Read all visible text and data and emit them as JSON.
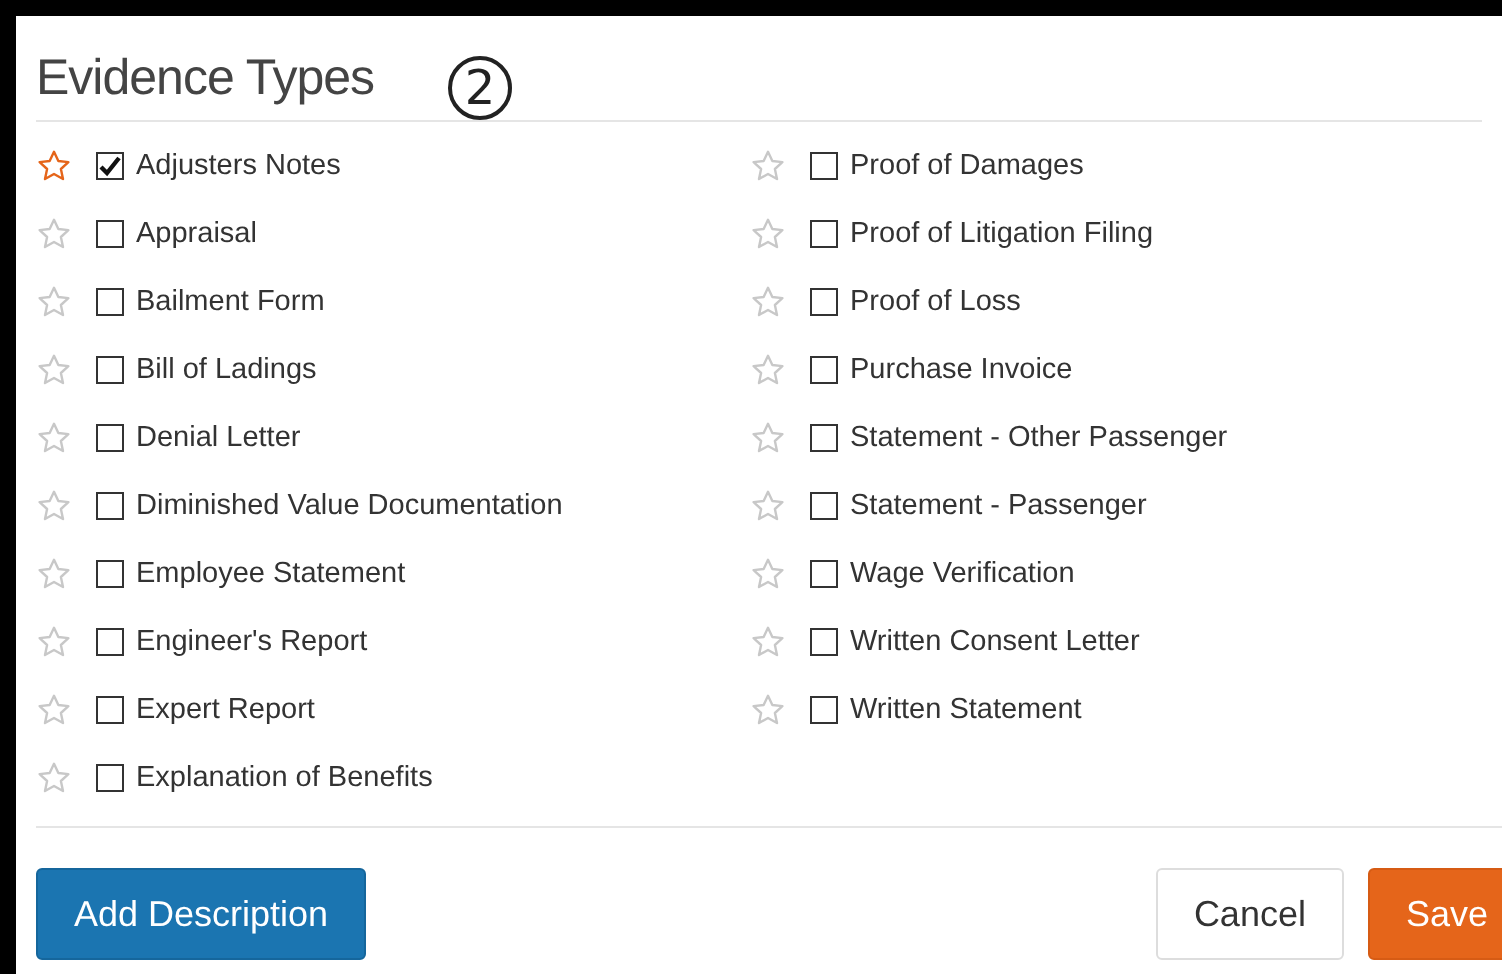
{
  "title": "Evidence Types",
  "annotation": "2",
  "columns": [
    [
      {
        "label": "Adjusters Notes",
        "starred": true,
        "checked": true
      },
      {
        "label": "Appraisal",
        "starred": false,
        "checked": false
      },
      {
        "label": "Bailment Form",
        "starred": false,
        "checked": false
      },
      {
        "label": "Bill of Ladings",
        "starred": false,
        "checked": false
      },
      {
        "label": "Denial Letter",
        "starred": false,
        "checked": false
      },
      {
        "label": "Diminished Value Documentation",
        "starred": false,
        "checked": false
      },
      {
        "label": "Employee Statement",
        "starred": false,
        "checked": false
      },
      {
        "label": "Engineer's Report",
        "starred": false,
        "checked": false
      },
      {
        "label": "Expert Report",
        "starred": false,
        "checked": false
      },
      {
        "label": "Explanation of Benefits",
        "starred": false,
        "checked": false
      }
    ],
    [
      {
        "label": "Proof of Damages",
        "starred": false,
        "checked": false
      },
      {
        "label": "Proof of Litigation Filing",
        "starred": false,
        "checked": false
      },
      {
        "label": "Proof of Loss",
        "starred": false,
        "checked": false
      },
      {
        "label": "Purchase Invoice",
        "starred": false,
        "checked": false
      },
      {
        "label": "Statement - Other Passenger",
        "starred": false,
        "checked": false
      },
      {
        "label": "Statement - Passenger",
        "starred": false,
        "checked": false
      },
      {
        "label": "Wage Verification",
        "starred": false,
        "checked": false
      },
      {
        "label": "Written Consent Letter",
        "starred": false,
        "checked": false
      },
      {
        "label": "Written Statement",
        "starred": false,
        "checked": false
      }
    ]
  ],
  "buttons": [
    {
      "label": "Add Description",
      "kind": "primary"
    },
    {
      "label": "Cancel",
      "kind": "default"
    },
    {
      "label": "Save",
      "kind": "warning"
    }
  ]
}
